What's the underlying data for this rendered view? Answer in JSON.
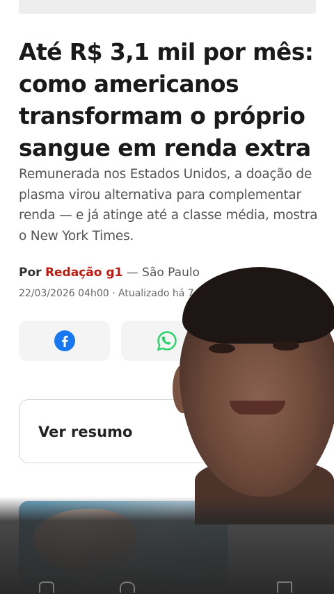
{
  "article": {
    "headline": "Até R$ 3,1 mil por mês: como americanos transformam o próprio sangue em renda extra",
    "subtitle": "Remunerada nos Estados Unidos, a doação de plasma virou alternativa para complementar renda — e já atinge até a classe média, mostra o New York Times.",
    "byline_prefix": "Por",
    "author": "Redação g1",
    "location": "— São Paulo",
    "dateline": "22/03/2026 04h00 · Atualizado há 7 h"
  },
  "share": {
    "facebook_icon": "facebook-icon",
    "whatsapp_icon": "whatsapp-icon"
  },
  "summary": {
    "label": "Ver resumo"
  },
  "bottom_nav": {
    "icons": [
      "home-icon",
      "search-icon",
      "menu-icon"
    ]
  },
  "colors": {
    "author_red": "#c4170c",
    "facebook_blue": "#1877f2",
    "whatsapp_green": "#25d366"
  }
}
